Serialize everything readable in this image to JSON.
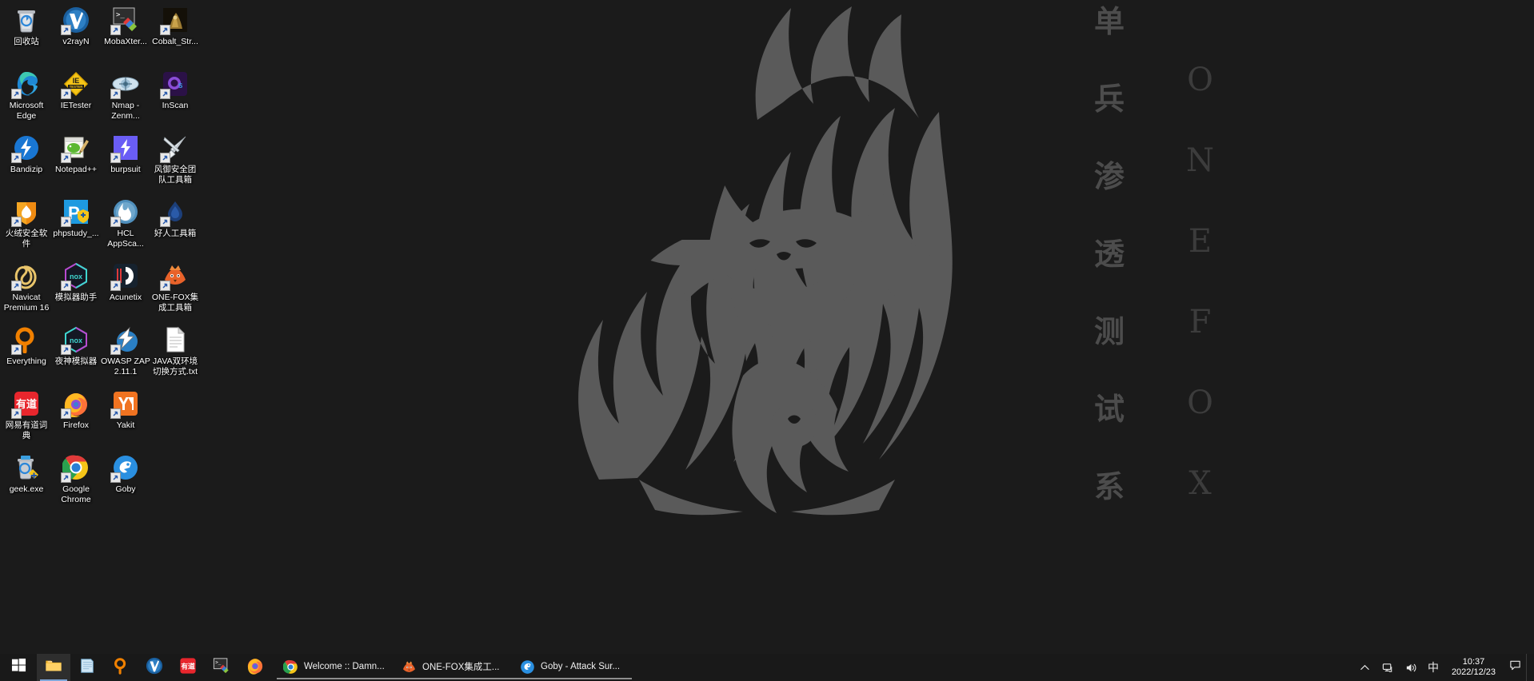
{
  "desktop": {
    "background_color": "#1b1b1b",
    "wallpaper": {
      "name": "ONE-FOX fox in flames emblem",
      "art_color": "#5a5a5a",
      "vertical_chinese": [
        "单",
        "兵",
        "渗",
        "透",
        "测",
        "试",
        "系"
      ],
      "vertical_english": [
        "O",
        "N",
        "E",
        "F",
        "O",
        "X"
      ]
    },
    "icons": [
      {
        "label": "回收站",
        "icon": "recycle-bin-icon",
        "shortcut": false
      },
      {
        "label": "v2rayN",
        "icon": "v2rayn-icon",
        "shortcut": true
      },
      {
        "label": "MobaXter...",
        "icon": "mobaxterm-icon",
        "shortcut": true
      },
      {
        "label": "Cobalt_Str...",
        "icon": "cobalt-strike-icon",
        "shortcut": true
      },
      {
        "label": "Microsoft Edge",
        "icon": "microsoft-edge-icon",
        "shortcut": true
      },
      {
        "label": "IETester",
        "icon": "ietester-icon",
        "shortcut": true
      },
      {
        "label": "Nmap - Zenm...",
        "icon": "nmap-zenmap-icon",
        "shortcut": true
      },
      {
        "label": "InScan",
        "icon": "inscan-icon",
        "shortcut": true
      },
      {
        "label": "Bandizip",
        "icon": "bandizip-icon",
        "shortcut": true
      },
      {
        "label": "Notepad++",
        "icon": "notepad-plus-plus-icon",
        "shortcut": true
      },
      {
        "label": "burpsuit",
        "icon": "burpsuite-icon",
        "shortcut": true
      },
      {
        "label": "风御安全团队工具箱",
        "icon": "fengyu-toolbox-icon",
        "shortcut": true
      },
      {
        "label": "火绒安全软件",
        "icon": "huorong-security-icon",
        "shortcut": true
      },
      {
        "label": "phpstudy_...",
        "icon": "phpstudy-icon",
        "shortcut": true
      },
      {
        "label": "HCL AppSca...",
        "icon": "hcl-appscan-icon",
        "shortcut": true
      },
      {
        "label": "好人工具箱",
        "icon": "haoren-toolbox-icon",
        "shortcut": true
      },
      {
        "label": "Navicat Premium 16",
        "icon": "navicat-icon",
        "shortcut": true
      },
      {
        "label": "模拟器助手",
        "icon": "nox-assistant-icon",
        "shortcut": true
      },
      {
        "label": "Acunetix",
        "icon": "acunetix-icon",
        "shortcut": true
      },
      {
        "label": "ONE-FOX集成工具箱",
        "icon": "one-fox-toolbox-icon",
        "shortcut": true
      },
      {
        "label": "Everything",
        "icon": "everything-icon",
        "shortcut": true
      },
      {
        "label": "夜神模拟器",
        "icon": "nox-player-icon",
        "shortcut": true
      },
      {
        "label": "OWASP ZAP 2.11.1",
        "icon": "owasp-zap-icon",
        "shortcut": true
      },
      {
        "label": "JAVA双环境切换方式.txt",
        "icon": "text-file-icon",
        "shortcut": false
      },
      {
        "label": "网易有道词典",
        "icon": "youdao-dict-icon",
        "shortcut": true
      },
      {
        "label": "Firefox",
        "icon": "firefox-icon",
        "shortcut": true
      },
      {
        "label": "Yakit",
        "icon": "yakit-icon",
        "shortcut": true
      },
      {
        "label": "",
        "icon": "",
        "shortcut": false
      },
      {
        "label": "geek.exe",
        "icon": "geek-uninstaller-icon",
        "shortcut": false
      },
      {
        "label": "Google Chrome",
        "icon": "google-chrome-icon",
        "shortcut": true
      },
      {
        "label": "Goby",
        "icon": "goby-icon",
        "shortcut": true
      }
    ]
  },
  "taskbar": {
    "start_label": "Start",
    "pinned": [
      {
        "name": "file-explorer",
        "icon": "folder-icon",
        "active": true
      },
      {
        "name": "notepad",
        "icon": "notepad-icon",
        "active": false
      },
      {
        "name": "everything-search",
        "icon": "search-icon",
        "active": false
      },
      {
        "name": "v2rayn",
        "icon": "v2rayn-icon",
        "active": false
      },
      {
        "name": "youdao-dict",
        "icon": "youdao-icon",
        "active": false
      },
      {
        "name": "mobaxterm",
        "icon": "terminal-icon",
        "active": false
      },
      {
        "name": "firefox",
        "icon": "firefox-icon",
        "active": false
      }
    ],
    "windows": [
      {
        "label": "Welcome :: Damn...",
        "icon": "google-chrome-icon"
      },
      {
        "label": "ONE-FOX集成工...",
        "icon": "one-fox-toolbox-icon"
      },
      {
        "label": "Goby - Attack Sur...",
        "icon": "goby-icon"
      }
    ],
    "tray": {
      "overflow_icon": "chevron-up-icon",
      "network_icon": "network-icon",
      "volume_icon": "speaker-icon",
      "ime_label": "中",
      "time": "10:37",
      "date": "2022/12/23",
      "notification_icon": "notification-icon"
    }
  }
}
